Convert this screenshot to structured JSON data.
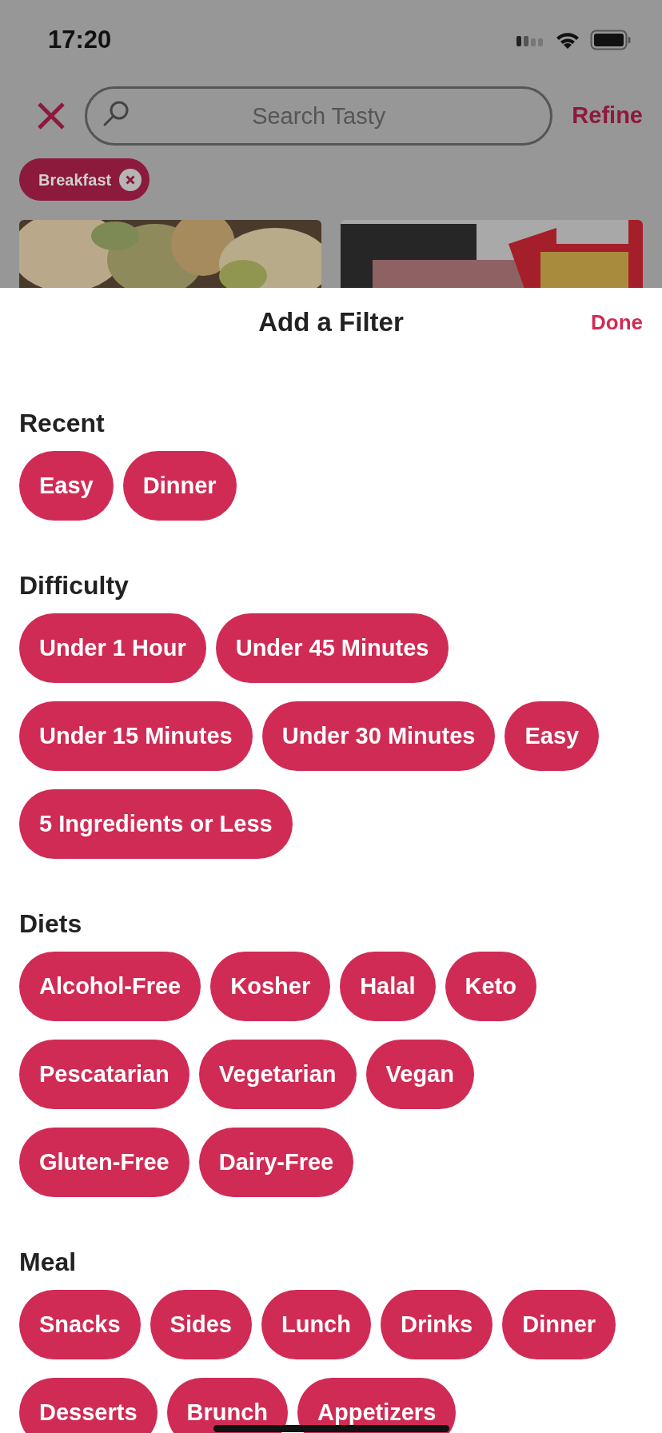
{
  "status_bar": {
    "time": "17:20"
  },
  "search_bar": {
    "placeholder": "Search Tasty",
    "refine_label": "Refine"
  },
  "active_filters": [
    {
      "label": "Breakfast"
    }
  ],
  "sheet": {
    "title": "Add a Filter",
    "done_label": "Done",
    "sections": [
      {
        "title": "Recent",
        "chips": [
          "Easy",
          "Dinner"
        ]
      },
      {
        "title": "Difficulty",
        "chips": [
          "Under 1 Hour",
          "Under 45 Minutes",
          "Under 15 Minutes",
          "Under 30 Minutes",
          "Easy",
          "5 Ingredients or Less"
        ]
      },
      {
        "title": "Diets",
        "chips": [
          "Alcohol-Free",
          "Kosher",
          "Halal",
          "Keto",
          "Pescatarian",
          "Vegetarian",
          "Vegan",
          "Gluten-Free",
          "Dairy-Free"
        ]
      },
      {
        "title": "Meal",
        "chips": [
          "Snacks",
          "Sides",
          "Lunch",
          "Drinks",
          "Dinner",
          "Desserts",
          "Brunch",
          "Appetizers"
        ]
      }
    ]
  }
}
